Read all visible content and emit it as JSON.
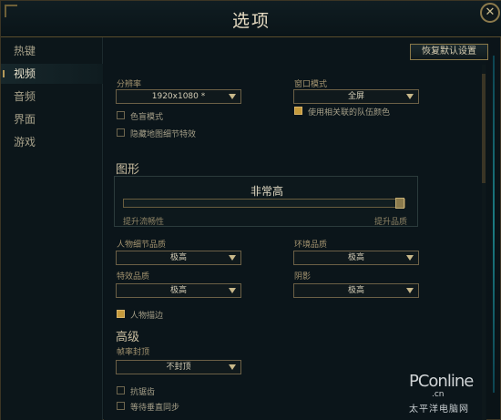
{
  "window": {
    "title": "选项",
    "close": "✕"
  },
  "sidebar": {
    "items": [
      {
        "label": "热键",
        "active": false
      },
      {
        "label": "视频",
        "active": true
      },
      {
        "label": "音频",
        "active": false
      },
      {
        "label": "界面",
        "active": false
      },
      {
        "label": "游戏",
        "active": false
      }
    ]
  },
  "toolbar": {
    "reset_label": "恢复默认设置"
  },
  "video": {
    "resolution_label": "分辨率",
    "resolution_value": "1920x1080 *",
    "window_mode_label": "窗口模式",
    "window_mode_value": "全屏",
    "color_blind_label": "色盲模式",
    "color_blind_checked": false,
    "hide_details_label": "隐藏地图细节特效",
    "hide_details_checked": false,
    "team_color_label": "使用相关联的队伍颜色",
    "team_color_checked": true
  },
  "graphics": {
    "title": "图形",
    "quality_value": "非常高",
    "slider_level": 1.0,
    "slider_left": "提升流畅性",
    "slider_right": "提升品质",
    "character_quality_label": "人物细节品质",
    "character_quality_value": "极高",
    "environment_quality_label": "环境品质",
    "environment_quality_value": "极高",
    "effects_quality_label": "特效品质",
    "effects_quality_value": "极高",
    "shadows_label": "阴影",
    "shadows_value": "极高",
    "outline_label": "人物描边",
    "outline_checked": true
  },
  "advanced": {
    "title": "高级",
    "frame_cap_label": "帧率封顶",
    "frame_cap_value": "不封顶",
    "antialias_label": "抗锯齿",
    "antialias_checked": false,
    "vsync_label": "等待垂直同步",
    "vsync_checked": false
  },
  "watermark": {
    "logo": "PConline",
    "cn": ".cn",
    "sub": "太平洋电脑网"
  },
  "colors": {
    "accent_gold": "#c59a3c",
    "border_gold": "#8a7848",
    "background": "#0b151a"
  }
}
